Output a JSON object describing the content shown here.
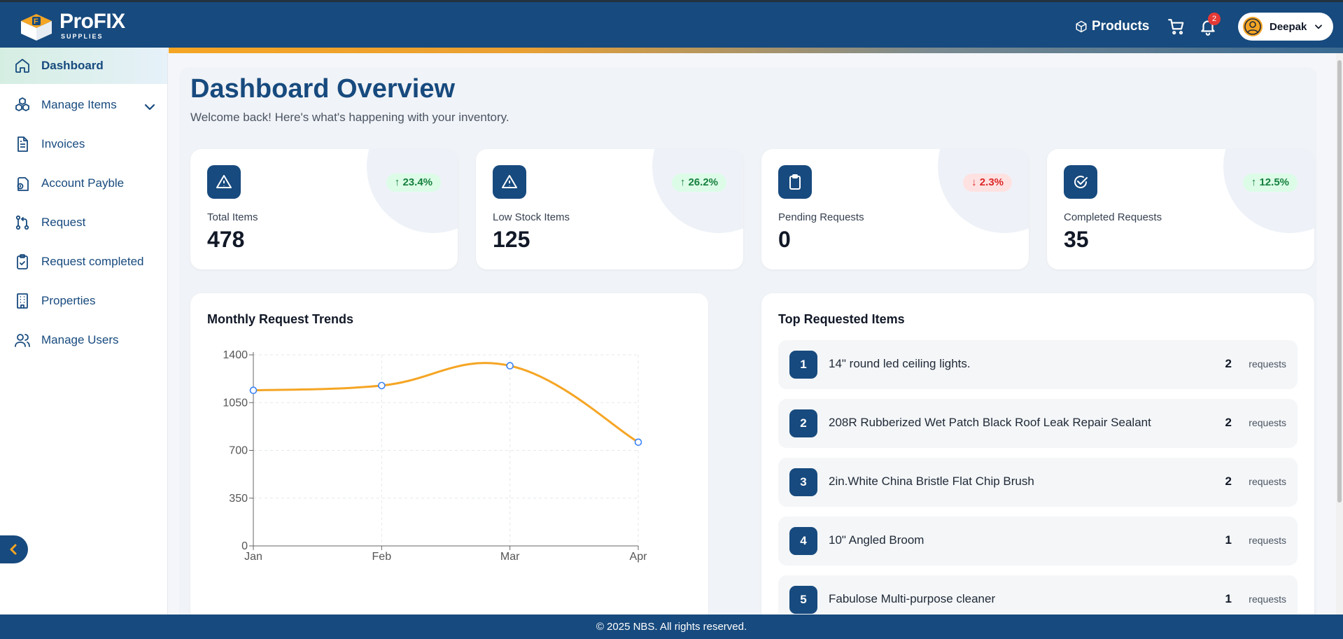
{
  "header": {
    "brand_name": "ProFIX",
    "brand_sub": "SUPPLIES",
    "products_label": "Products",
    "notification_count": "2",
    "user_name": "Deepak"
  },
  "sidebar": {
    "items": [
      {
        "label": "Dashboard",
        "icon": "home-icon",
        "active": true
      },
      {
        "label": "Manage Items",
        "icon": "boxes-icon"
      },
      {
        "label": "Invoices",
        "icon": "document-icon"
      },
      {
        "label": "Account Payble",
        "icon": "payable-icon"
      },
      {
        "label": "Request",
        "icon": "git-pull-icon"
      },
      {
        "label": "Request completed",
        "icon": "clipboard-check-icon"
      },
      {
        "label": "Properties",
        "icon": "building-icon"
      },
      {
        "label": "Manage Users",
        "icon": "users-icon"
      }
    ]
  },
  "page": {
    "title": "Dashboard Overview",
    "subtitle": "Welcome back! Here's what's happening with your inventory."
  },
  "stats": [
    {
      "label": "Total Items",
      "value": "478",
      "trend": "↑ 23.4%",
      "direction": "up",
      "icon": "warning-icon"
    },
    {
      "label": "Low Stock Items",
      "value": "125",
      "trend": "↑ 26.2%",
      "direction": "up",
      "icon": "warning-icon"
    },
    {
      "label": "Pending Requests",
      "value": "0",
      "trend": "↓ 2.3%",
      "direction": "down",
      "icon": "clipboard-icon"
    },
    {
      "label": "Completed Requests",
      "value": "35",
      "trend": "↑ 12.5%",
      "direction": "up",
      "icon": "check-circle-icon"
    }
  ],
  "trend_card": {
    "title": "Monthly Request Trends"
  },
  "chart_data": {
    "type": "line",
    "title": "Monthly Request Trends",
    "categories": [
      "Jan",
      "Feb",
      "Mar",
      "Apr"
    ],
    "series": [
      {
        "values": [
          1140,
          1175,
          1320,
          760
        ]
      }
    ],
    "yticks": [
      "0",
      "350",
      "700",
      "1050",
      "1400"
    ],
    "ylim": [
      0,
      1400
    ],
    "grid": true,
    "line_color": "#f5a524"
  },
  "top_items": {
    "title": "Top Requested Items",
    "unit": "requests",
    "items": [
      {
        "rank": "1",
        "name": "14\" round led ceiling lights.",
        "count": "2"
      },
      {
        "rank": "2",
        "name": "208R Rubberized Wet Patch Black Roof Leak Repair Sealant",
        "count": "2"
      },
      {
        "rank": "3",
        "name": "2in.White China Bristle Flat Chip Brush",
        "count": "2"
      },
      {
        "rank": "4",
        "name": "10\" Angled Broom",
        "count": "1"
      },
      {
        "rank": "5",
        "name": "Fabulose Multi-purpose cleaner",
        "count": "1"
      }
    ]
  },
  "footer": {
    "text": "© 2025 NBS. All rights reserved."
  },
  "colors": {
    "primary": "#174a7e",
    "accent": "#f5a524",
    "up": "#15803d",
    "down": "#dc2626"
  }
}
